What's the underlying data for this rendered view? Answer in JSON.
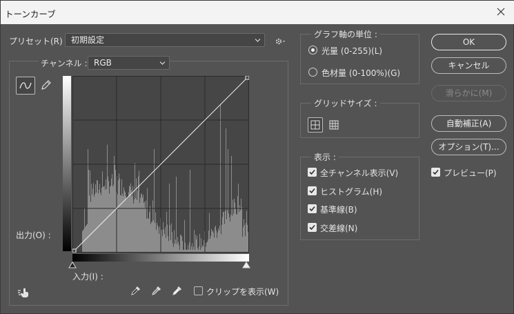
{
  "window": {
    "title": "トーンカーブ"
  },
  "preset": {
    "label": "プリセット(R) :",
    "value": "初期設定"
  },
  "channel": {
    "label": "チャンネル :",
    "value": "RGB"
  },
  "output_label": "出力(O) :",
  "input_label": "入力(I) :",
  "show_clipping": {
    "label": "クリップを表示(W)",
    "checked": false
  },
  "graph_unit": {
    "legend": "グラフ軸の単位 :",
    "options": [
      {
        "label": "光量 (0-255)(L)",
        "selected": true
      },
      {
        "label": "色材量 (0-100%)(G)",
        "selected": false
      }
    ]
  },
  "grid_size": {
    "legend": "グリッドサイズ :"
  },
  "display": {
    "legend": "表示 :",
    "options": [
      {
        "label": "全チャンネル表示(V)",
        "checked": true
      },
      {
        "label": "ヒストグラム(H)",
        "checked": true
      },
      {
        "label": "基準線(B)",
        "checked": true
      },
      {
        "label": "交差線(N)",
        "checked": true
      }
    ]
  },
  "buttons": {
    "ok": "OK",
    "cancel": "キャンセル",
    "smooth": "滑らかに(M)",
    "auto": "自動補正(A)",
    "options": "オプション(T)..."
  },
  "preview": {
    "label": "プレビュー(P)",
    "checked": true
  },
  "colors": {
    "dialog_bg": "#535353",
    "graph_bg": "#464646",
    "histogram": "#8c8c8c"
  }
}
